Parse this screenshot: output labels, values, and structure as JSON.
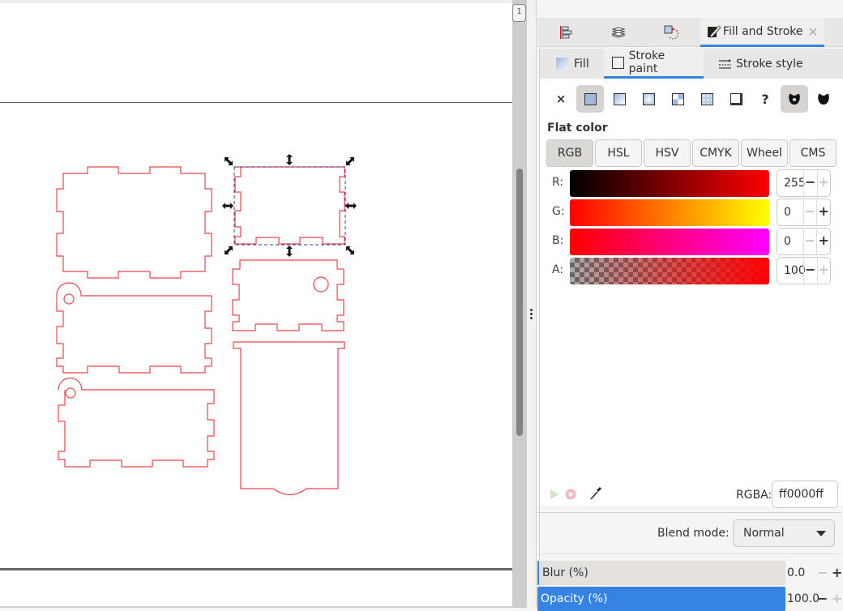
{
  "canvas": {
    "page_indicator": "1"
  },
  "dock": {
    "tabs": [
      {
        "name": "align-and-distribute",
        "label": ""
      },
      {
        "name": "layers",
        "label": ""
      },
      {
        "name": "transform",
        "label": ""
      },
      {
        "name": "fill-and-stroke",
        "label": "Fill and Stroke",
        "active": true
      }
    ],
    "close_icon": "×"
  },
  "fill_stroke": {
    "sub_tabs": [
      {
        "label": "Fill"
      },
      {
        "label": "Stroke paint",
        "active": true
      },
      {
        "label": "Stroke style"
      }
    ],
    "paint_types": [
      {
        "name": "no-paint",
        "glyph": "×"
      },
      {
        "name": "flat-color",
        "active": true
      },
      {
        "name": "linear-gradient"
      },
      {
        "name": "radial-gradient"
      },
      {
        "name": "pattern"
      },
      {
        "name": "swatch"
      },
      {
        "name": "mesh"
      },
      {
        "name": "unset",
        "glyph": "?"
      },
      {
        "name": "fill-rule-evenodd",
        "active": true
      },
      {
        "name": "fill-rule-nonzero"
      }
    ],
    "paint_mode_label": "Flat color",
    "color_modes": [
      "RGB",
      "HSL",
      "HSV",
      "CMYK",
      "Wheel",
      "CMS"
    ],
    "active_color_mode": "RGB",
    "channels": [
      {
        "label": "R:",
        "value": "255",
        "fraction": 1.0
      },
      {
        "label": "G:",
        "value": "0",
        "fraction": 0.0
      },
      {
        "label": "B:",
        "value": "0",
        "fraction": 0.0
      },
      {
        "label": "A:",
        "value": "100",
        "fraction": 1.0
      }
    ],
    "rgba_label": "RGBA:",
    "rgba_value": "ff0000ff",
    "blend_mode_label": "Blend mode:",
    "blend_mode_value": "Normal",
    "blur_label": "Blur (%)",
    "blur_value": "0.0",
    "opacity_label": "Opacity (%)",
    "opacity_value": "100.0",
    "minus": "−",
    "plus": "+"
  },
  "colors": {
    "accent": "#3584e4",
    "stroke": "#e8474c",
    "selection_dash": "#3a3aa0"
  }
}
